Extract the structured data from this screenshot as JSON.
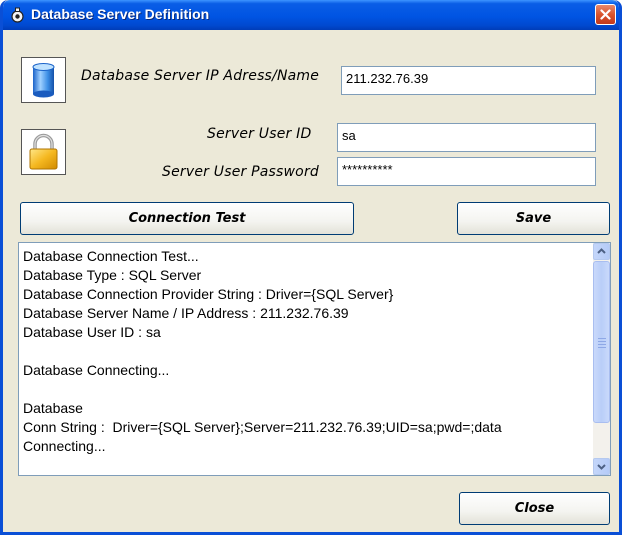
{
  "window": {
    "title": "Database Server Definition",
    "accent_color": "#0054e3",
    "close_color": "#d9542d"
  },
  "icons": {
    "title": "app-icon",
    "database": "database-icon",
    "lock": "lock-icon",
    "close": "close-icon"
  },
  "server": {
    "ip_label": "Database Server IP Adress/Name",
    "ip_value": "211.232.76.39"
  },
  "credentials": {
    "user_id_label": "Server User ID",
    "user_id_value": "sa",
    "password_label": "Server User Password",
    "password_value": "**********"
  },
  "buttons": {
    "connection_test": "Connection Test",
    "save": "Save",
    "close": "Close"
  },
  "log": {
    "lines": [
      "Database Connection Test...",
      "Database Type : SQL Server",
      "Database Connection Provider String : Driver={SQL Server}",
      "Database Server Name / IP Address : 211.232.76.39",
      "Database User ID : sa",
      "",
      "Database Connecting...",
      "",
      "Database",
      "Conn String :  Driver={SQL Server};Server=211.232.76.39;UID=sa;pwd=;data",
      "Connecting..."
    ]
  }
}
